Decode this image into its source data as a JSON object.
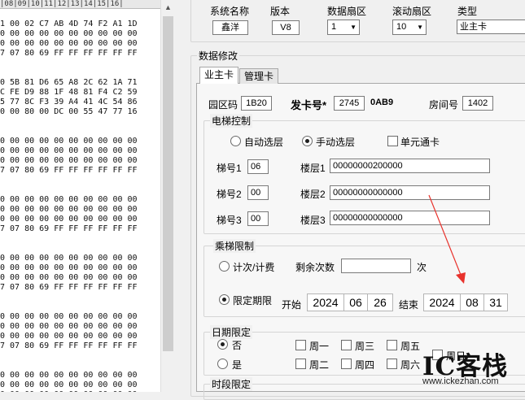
{
  "hex": {
    "header": "|08|09|10|11|12|13|14|15|16|",
    "rows": [
      "1 00 02 C7 AB 4D 74 F2 A1 1D",
      "0 00 00 00 00 00 00 00 00 00",
      "0 00 00 00 00 00 00 00 00 00",
      "7 07 80 69 FF FF FF FF FF FF",
      "",
      "",
      "0 5B 81 D6 65 A8 2C 62 1A 71",
      "C FE D9 88 1F 48 81 F4 C2 59",
      "5 77 8C F3 39 A4 41 4C 54 86",
      "0 00 80 00 DC 00 55 47 77 16",
      "",
      "",
      "0 00 00 00 00 00 00 00 00 00",
      "0 00 00 00 00 00 00 00 00 00",
      "0 00 00 00 00 00 00 00 00 00",
      "7 07 80 69 FF FF FF FF FF FF",
      "",
      "",
      "0 00 00 00 00 00 00 00 00 00",
      "0 00 00 00 00 00 00 00 00 00",
      "0 00 00 00 00 00 00 00 00 00",
      "7 07 80 69 FF FF FF FF FF FF",
      "",
      "",
      "0 00 00 00 00 00 00 00 00 00",
      "0 00 00 00 00 00 00 00 00 00",
      "0 00 00 00 00 00 00 00 00 00",
      "7 07 80 69 FF FF FF FF FF FF",
      "",
      "",
      "0 00 00 00 00 00 00 00 00 00",
      "0 00 00 00 00 00 00 00 00 00",
      "0 00 00 00 00 00 00 00 00 00",
      "7 07 80 69 FF FF FF FF FF FF",
      "",
      "",
      "0 00 00 00 00 00 00 00 00 00",
      "0 00 00 00 00 00 00 00 00 00",
      "0 00 00 00 00 00 00 00 00 00"
    ]
  },
  "top": {
    "system_name_label": "系统名称",
    "system_name_value": "鑫洋",
    "version_label": "版本",
    "version_value": "V8",
    "data_sector_label": "数据扇区",
    "data_sector_value": "1",
    "scroll_sector_label": "滚动扇区",
    "scroll_sector_value": "10",
    "type_label": "类型",
    "type_value": "业主卡"
  },
  "data_edit": {
    "title": "数据修改",
    "tabs": [
      "业主卡",
      "管理卡"
    ]
  },
  "owner": {
    "zone_label": "园区码",
    "zone_value": "1B20",
    "card_no_label": "发卡号*",
    "card_no_value": "2745",
    "card_no_extra": "0AB9",
    "room_label": "房间号",
    "room_value": "1402"
  },
  "elevator": {
    "title": "电梯控制",
    "auto_label": "自动选层",
    "manual_label": "手动选层",
    "unit_pass_label": "单元通卡",
    "rows": [
      {
        "ladder_label": "梯号1",
        "ladder_value": "06",
        "floor_label": "楼层1",
        "floor_value": "00000000200000"
      },
      {
        "ladder_label": "梯号2",
        "ladder_value": "00",
        "floor_label": "楼层2",
        "floor_value": "00000000000000"
      },
      {
        "ladder_label": "梯号3",
        "ladder_value": "00",
        "floor_label": "楼层3",
        "floor_value": "00000000000000"
      }
    ]
  },
  "limit": {
    "title": "乘梯限制",
    "count_label": "计次/计费",
    "remaining_label": "剩余次数",
    "remaining_value": "",
    "times_unit": "次",
    "period_label": "限定期限",
    "start_label": "开始",
    "start_year": "2024",
    "start_month": "06",
    "start_day": "26",
    "end_label": "结束",
    "end_year": "2024",
    "end_month": "08",
    "end_day": "31"
  },
  "date_limit": {
    "title": "日期限定",
    "no_label": "否",
    "yes_label": "是",
    "days": [
      "周一",
      "周三",
      "周五",
      "周日",
      "周二",
      "周四",
      "周六"
    ]
  },
  "time_limit": {
    "title": "时段限定"
  },
  "watermark": {
    "logo": "IC客栈",
    "url": "www.ickezhan.com"
  },
  "colors": {
    "annotation_arrow": "#e8322c"
  }
}
